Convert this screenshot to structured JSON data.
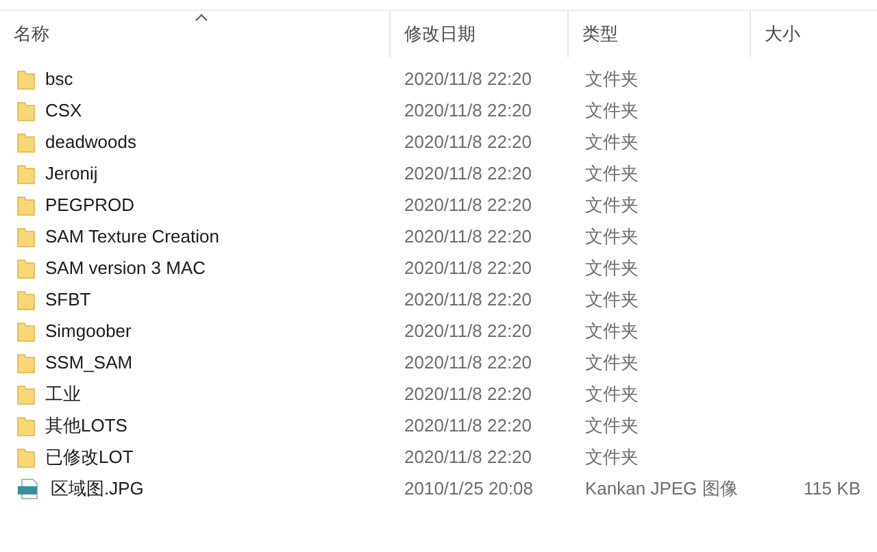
{
  "columns": [
    {
      "label": "名称",
      "sorted": true
    },
    {
      "label": "修改日期",
      "sorted": false
    },
    {
      "label": "类型",
      "sorted": false
    },
    {
      "label": "大小",
      "sorted": false
    }
  ],
  "rows": [
    {
      "kind": "folder",
      "name": "bsc",
      "date": "2020/11/8 22:20",
      "type": "文件夹"
    },
    {
      "kind": "folder",
      "name": "CSX",
      "date": "2020/11/8 22:20",
      "type": "文件夹"
    },
    {
      "kind": "folder",
      "name": "deadwoods",
      "date": "2020/11/8 22:20",
      "type": "文件夹"
    },
    {
      "kind": "folder",
      "name": "Jeronij",
      "date": "2020/11/8 22:20",
      "type": "文件夹"
    },
    {
      "kind": "folder",
      "name": "PEGPROD",
      "date": "2020/11/8 22:20",
      "type": "文件夹"
    },
    {
      "kind": "folder",
      "name": "SAM Texture Creation",
      "date": "2020/11/8 22:20",
      "type": "文件夹"
    },
    {
      "kind": "folder",
      "name": "SAM version 3 MAC",
      "date": "2020/11/8 22:20",
      "type": "文件夹"
    },
    {
      "kind": "folder",
      "name": "SFBT",
      "date": "2020/11/8 22:20",
      "type": "文件夹"
    },
    {
      "kind": "folder",
      "name": "Simgoober",
      "date": "2020/11/8 22:20",
      "type": "文件夹"
    },
    {
      "kind": "folder",
      "name": "SSM_SAM",
      "date": "2020/11/8 22:20",
      "type": "文件夹"
    },
    {
      "kind": "folder",
      "name": "工业",
      "date": "2020/11/8 22:20",
      "type": "文件夹"
    },
    {
      "kind": "folder",
      "name": "其他LOTS",
      "date": "2020/11/8 22:20",
      "type": "文件夹"
    },
    {
      "kind": "folder",
      "name": "已修改LOT",
      "date": "2020/11/8 22:20",
      "type": "文件夹"
    },
    {
      "kind": "image",
      "name": "区域图.JPG",
      "date": "2010/1/25 20:08",
      "type": "Kankan JPEG 图像",
      "size": "115 KB"
    }
  ]
}
